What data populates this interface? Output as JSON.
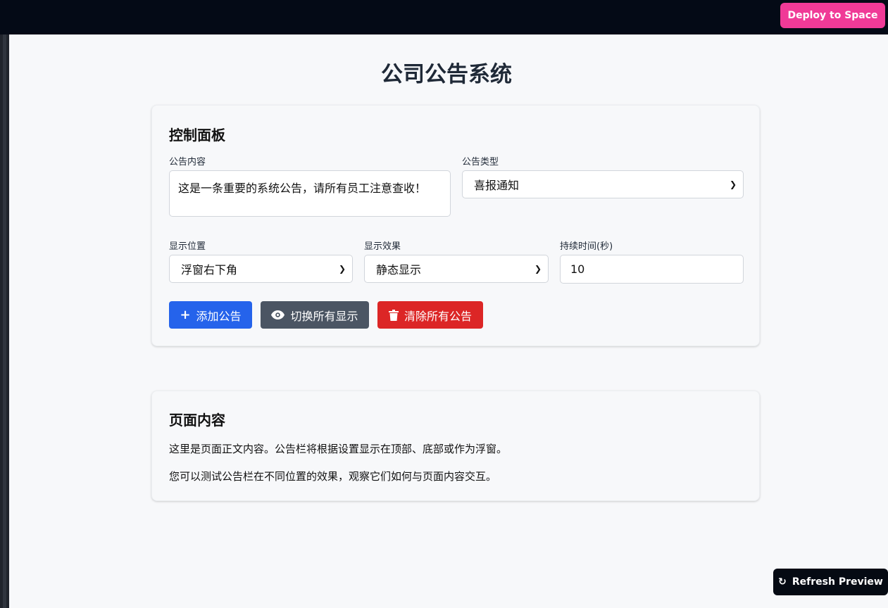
{
  "header": {
    "deploy_label": "Deploy to Space"
  },
  "page": {
    "title": "公司公告系统"
  },
  "control_panel": {
    "title": "控制面板",
    "content_label": "公告内容",
    "content_value": "这是一条重要的系统公告，请所有员工注意查收！",
    "type_label": "公告类型",
    "type_value": "喜报通知",
    "position_label": "显示位置",
    "position_value": "浮窗右下角",
    "effect_label": "显示效果",
    "effect_value": "静态显示",
    "duration_label": "持续时间(秒)",
    "duration_value": "10",
    "add_label": "添加公告",
    "toggle_label": "切换所有显示",
    "clear_label": "清除所有公告"
  },
  "content_card": {
    "title": "页面内容",
    "paragraph1": "这里是页面正文内容。公告栏将根据设置显示在顶部、底部或作为浮窗。",
    "paragraph2": "您可以测试公告栏在不同位置的效果，观察它们如何与页面内容交互。"
  },
  "refresh": {
    "label": "Refresh Preview"
  },
  "colors": {
    "deploy": "#f03a97",
    "primary": "#2563eb",
    "secondary": "#4b5563",
    "danger": "#dc2626",
    "topbar": "#040a16"
  }
}
